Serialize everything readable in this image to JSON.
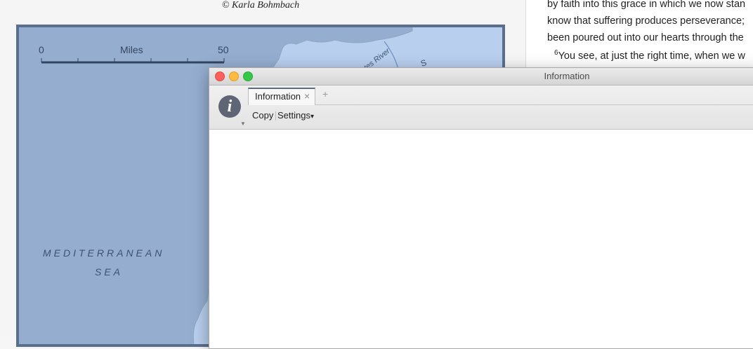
{
  "map": {
    "credit": "© Karla Bohmbach",
    "scale": {
      "start": "0",
      "unit": "Miles",
      "end": "50"
    },
    "sea_label": [
      "MEDITERRANEAN",
      "SEA"
    ],
    "river_label": "tes River",
    "fragment_label": "S",
    "colors": {
      "sea": "#95aed0",
      "land": "#b8cfee",
      "frame": "#5a6f8e"
    }
  },
  "text_pane": {
    "lines": [
      "by faith into this grace in which we now stan",
      "know that suffering produces perseverance;",
      "been poured out into our hearts through the"
    ],
    "verse": {
      "number": "6",
      "text": "You see, at just the right time, when we w"
    }
  },
  "info_window": {
    "title": "Information",
    "tab_label": "Information",
    "tab_close": "×",
    "tab_add": "+",
    "icon_glyph": "i",
    "toolbar": {
      "copy_label": "Copy",
      "settings_label": "Settings",
      "settings_caret": "▾"
    }
  }
}
